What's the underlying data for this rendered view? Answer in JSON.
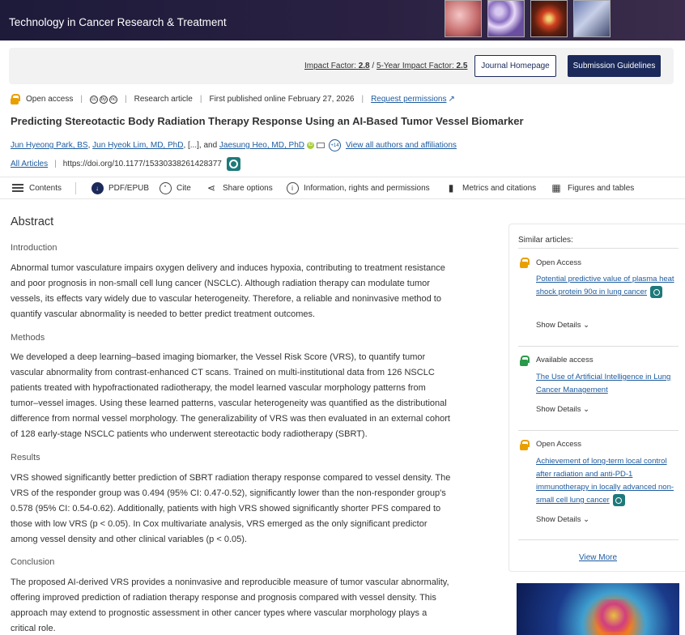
{
  "header": {
    "journal_title": "Technology in Cancer Research & Treatment"
  },
  "infobar": {
    "impact_label": "Impact Factor:",
    "impact_value": "2.8",
    "impact_sep": "/",
    "five_year_label": "5-Year Impact Factor:",
    "five_year_value": "2.5",
    "journal_homepage": "Journal Homepage",
    "submission_guidelines": "Submission Guidelines"
  },
  "meta": {
    "access": "Open access",
    "license_icons": [
      "cc",
      "by",
      "nc"
    ],
    "type": "Research article",
    "published": "First published online February 27, 2026",
    "permissions": "Request permissions"
  },
  "article": {
    "title": "Predicting Stereotactic Body Radiation Therapy Response Using an AI-Based Tumor Vessel Biomarker",
    "author1": "Jun Hyeong Park, BS",
    "author_sep1": ",",
    "author2": "Jun Hyeok Lim, MD, PhD",
    "author_sep2": ",",
    "ellipsis": "[...],",
    "and": "and",
    "author3": "Jaesung Heo, MD, PhD",
    "more_count": "+14",
    "view_all": "View all authors and affiliations",
    "all_articles": "All Articles",
    "doi": "https://doi.org/10.1177/15330338261428377"
  },
  "toolbar": {
    "contents": "Contents",
    "pdf": "PDF/EPUB",
    "cite": "Cite",
    "share": "Share options",
    "info": "Information, rights and permissions",
    "metrics": "Metrics and citations",
    "figures": "Figures and tables"
  },
  "abstract": {
    "heading": "Abstract",
    "intro_h": "Introduction",
    "intro": "Abnormal tumor vasculature impairs oxygen delivery and induces hypoxia, contributing to treatment resistance and poor prognosis in non-small cell lung cancer (NSCLC). Although radiation therapy can modulate tumor vessels, its effects vary widely due to vascular heterogeneity. Therefore, a reliable and noninvasive method to quantify vascular abnormality is needed to better predict treatment outcomes.",
    "methods_h": "Methods",
    "methods": "We developed a deep learning–based imaging biomarker, the Vessel Risk Score (VRS), to quantify tumor vascular abnormality from contrast-enhanced CT scans. Trained on multi-institutional data from 126 NSCLC patients treated with hypofractionated radiotherapy, the model learned vascular morphology patterns from tumor–vessel images. Using these learned patterns, vascular heterogeneity was quantified as the distributional difference from normal vessel morphology. The generalizability of VRS was then evaluated in an external cohort of 128 early-stage NSCLC patients who underwent stereotactic body radiotherapy (SBRT).",
    "results_h": "Results",
    "results": "VRS showed significantly better prediction of SBRT radiation therapy response compared to vessel density. The VRS of the responder group was 0.494 (95% CI: 0.47-0.52), significantly lower than the non-responder group's 0.578 (95% CI: 0.54-0.62). Additionally, patients with high VRS showed significantly shorter PFS compared to those with low VRS (p < 0.05). In Cox multivariate analysis, VRS emerged as the only significant predictor among vessel density and other clinical variables (p < 0.05).",
    "conclusion_h": "Conclusion",
    "conclusion": "The proposed AI-derived VRS provides a noninvasive and reproducible measure of tumor vascular abnormality, offering improved prediction of radiation therapy response and prognosis compared with vessel density. This approach may extend to prognostic assessment in other cancer types where vascular morphology plays a critical role."
  },
  "sidebar": {
    "heading": "Similar articles:",
    "items": [
      {
        "access": "Open Access",
        "title": "Potential predictive value of plasma heat shock protein 90α in lung cancer",
        "details": "Show Details"
      },
      {
        "access": "Available access",
        "title": "The Use of Artificial Intelligence in Lung Cancer Management",
        "details": "Show Details"
      },
      {
        "access": "Open Access",
        "title": "Achievement of long-term local control after radiation and anti-PD-1 immunotherapy in locally advanced non-small cell lung cancer",
        "details": "Show Details"
      }
    ],
    "view_more": "View More"
  }
}
